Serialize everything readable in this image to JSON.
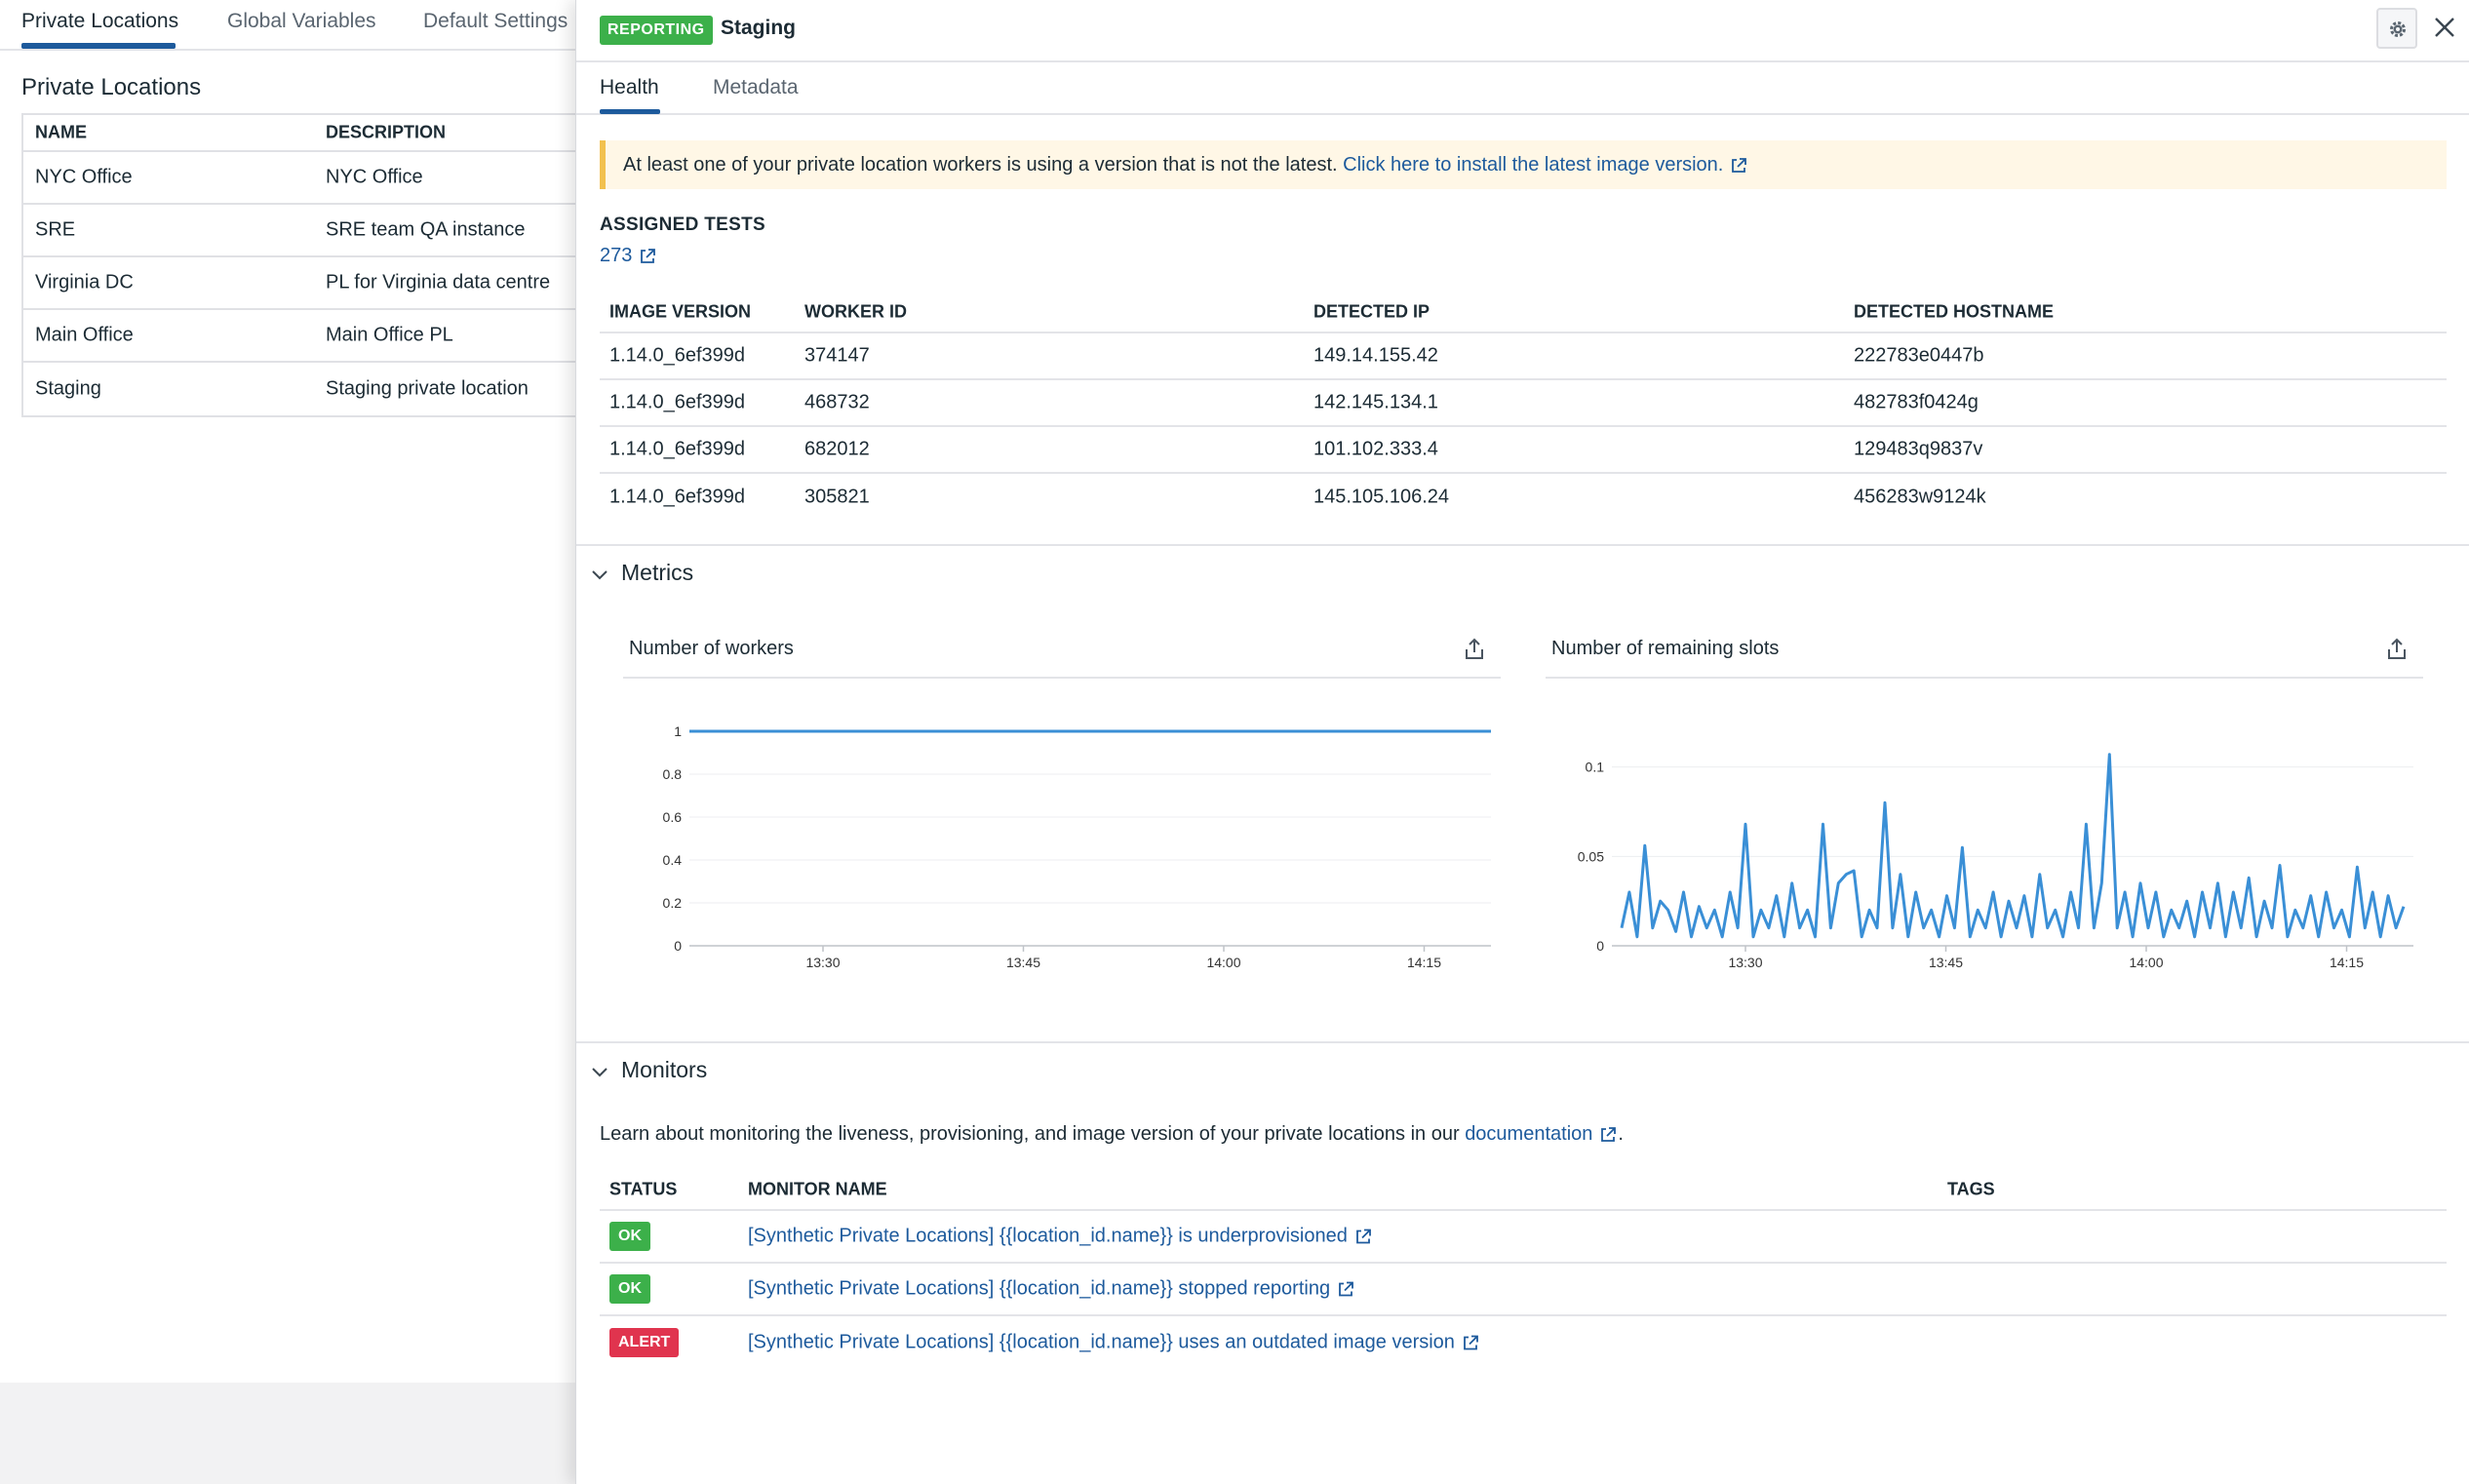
{
  "background": {
    "tabs": [
      "Private Locations",
      "Global Variables",
      "Default Settings"
    ],
    "title": "Private Locations",
    "columns": [
      "NAME",
      "DESCRIPTION"
    ],
    "rows": [
      [
        "NYC Office",
        "NYC Office"
      ],
      [
        "SRE",
        "SRE team QA instance"
      ],
      [
        "Virginia DC",
        "PL for Virginia data centre"
      ],
      [
        "Main Office",
        "Main Office PL"
      ],
      [
        "Staging",
        "Staging private location"
      ]
    ]
  },
  "panel": {
    "status": "REPORTING",
    "title": "Staging",
    "tabs": [
      "Health",
      "Metadata"
    ],
    "warning": {
      "text": "At least one of your private location workers is using a version that is not the latest.",
      "link": "Click here to install the latest image version."
    },
    "assigned_tests": {
      "label": "ASSIGNED TESTS",
      "count": "273"
    },
    "workers": {
      "columns": [
        "IMAGE VERSION",
        "WORKER ID",
        "DETECTED IP",
        "DETECTED HOSTNAME"
      ],
      "rows": [
        [
          "1.14.0_6ef399d",
          "374147",
          "149.14.155.42",
          "222783e0447b"
        ],
        [
          "1.14.0_6ef399d",
          "468732",
          "142.145.134.1",
          "482783f0424g"
        ],
        [
          "1.14.0_6ef399d",
          "682012",
          "101.102.333.4",
          "129483q9837v"
        ],
        [
          "1.14.0_6ef399d",
          "305821",
          "145.105.106.24",
          "456283w9124k"
        ]
      ]
    },
    "metrics": {
      "title": "Metrics",
      "charts": [
        {
          "title": "Number of workers",
          "icon": "export-icon"
        },
        {
          "title": "Number of remaining slots",
          "icon": "export-icon"
        }
      ]
    },
    "monitors": {
      "title": "Monitors",
      "intro": "Learn about monitoring the liveness, provisioning, and image version of your private locations in our",
      "intro_link": "documentation",
      "intro_end": ".",
      "columns": [
        "STATUS",
        "MONITOR NAME",
        "TAGS"
      ],
      "rows": [
        {
          "status": "OK",
          "name": "[Synthetic Private Locations] {{location_id.name}} is underprovisioned"
        },
        {
          "status": "OK",
          "name": "[Synthetic Private Locations] {{location_id.name}} stopped reporting"
        },
        {
          "status": "ALERT",
          "name": "[Synthetic Private Locations] {{location_id.name}} uses an outdated image version"
        }
      ]
    }
  },
  "colors": {
    "accent": "#1d5a9c",
    "ok": "#3cb04a",
    "alert": "#e0344e",
    "line": "#3a8fd6",
    "warning_bg": "#fff7e6",
    "warning_border": "#f2c14f"
  },
  "chart_data": [
    {
      "type": "line",
      "title": "Number of workers",
      "x": [
        "13:20",
        "13:30",
        "13:45",
        "14:00",
        "14:15",
        "14:20"
      ],
      "xticks": [
        "13:30",
        "13:45",
        "14:00",
        "14:15"
      ],
      "yticks": [
        "0",
        "0.2",
        "0.4",
        "0.6",
        "0.8",
        "1"
      ],
      "ylim": [
        0,
        1
      ],
      "series": [
        {
          "values": [
            1,
            1,
            1,
            1,
            1,
            1
          ]
        }
      ]
    },
    {
      "type": "line",
      "title": "Number of remaining slots",
      "xrange": [
        "13:20",
        "14:20"
      ],
      "xticks": [
        "13:30",
        "13:45",
        "14:00",
        "14:15"
      ],
      "yticks": [
        "0",
        "0.05",
        "0.1"
      ],
      "ylim": [
        0,
        0.12
      ],
      "series": [
        {
          "values": [
            0.01,
            0.03,
            0.005,
            0.056,
            0.01,
            0.025,
            0.02,
            0.008,
            0.03,
            0.005,
            0.022,
            0.01,
            0.02,
            0.005,
            0.03,
            0.01,
            0.068,
            0.005,
            0.02,
            0.01,
            0.028,
            0.005,
            0.035,
            0.01,
            0.02,
            0.005,
            0.068,
            0.01,
            0.035,
            0.04,
            0.042,
            0.005,
            0.02,
            0.01,
            0.08,
            0.01,
            0.04,
            0.005,
            0.03,
            0.01,
            0.02,
            0.005,
            0.028,
            0.01,
            0.055,
            0.005,
            0.02,
            0.01,
            0.03,
            0.005,
            0.025,
            0.01,
            0.028,
            0.005,
            0.04,
            0.01,
            0.02,
            0.005,
            0.03,
            0.01,
            0.068,
            0.01,
            0.035,
            0.107,
            0.01,
            0.03,
            0.005,
            0.035,
            0.01,
            0.03,
            0.005,
            0.02,
            0.01,
            0.025,
            0.005,
            0.03,
            0.01,
            0.035,
            0.005,
            0.03,
            0.01,
            0.038,
            0.005,
            0.025,
            0.01,
            0.045,
            0.005,
            0.02,
            0.01,
            0.028,
            0.005,
            0.03,
            0.01,
            0.02,
            0.005,
            0.044,
            0.01,
            0.03,
            0.005,
            0.028,
            0.01,
            0.022
          ]
        }
      ]
    }
  ]
}
